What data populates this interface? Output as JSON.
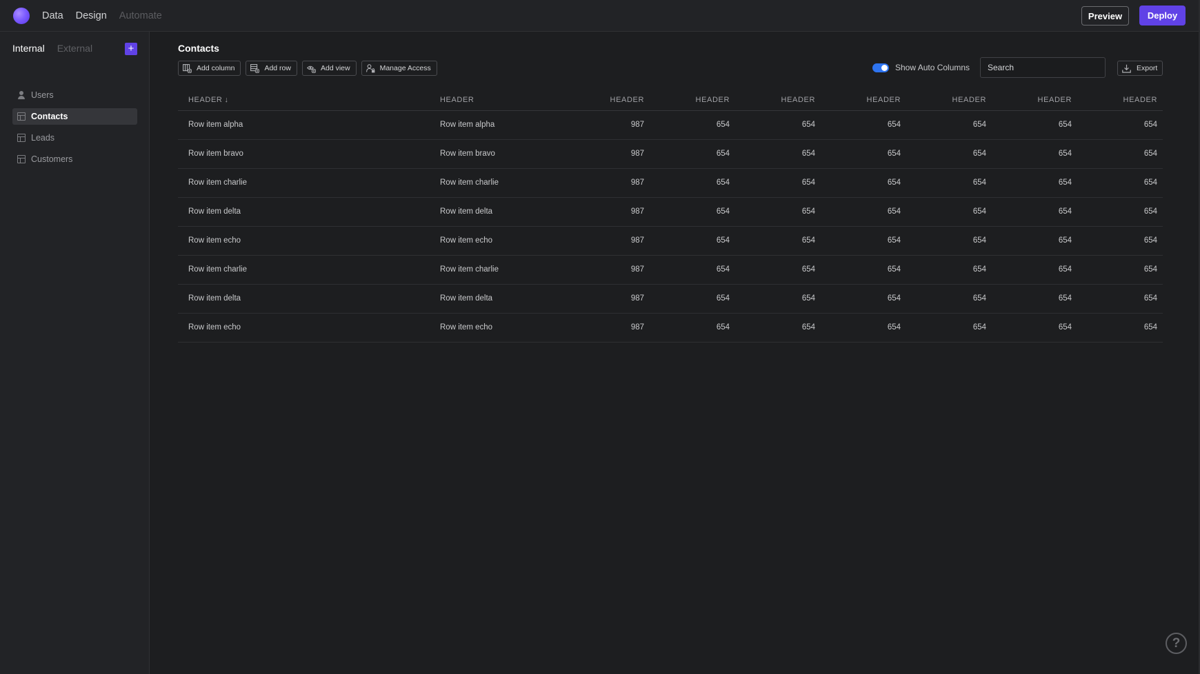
{
  "topbar": {
    "nav": [
      {
        "label": "Data",
        "enabled": true
      },
      {
        "label": "Design",
        "enabled": true
      },
      {
        "label": "Automate",
        "enabled": false
      }
    ],
    "preview_label": "Preview",
    "deploy_label": "Deploy",
    "accent_color": "#6042e6"
  },
  "sidebar": {
    "tabs": [
      {
        "label": "Internal",
        "active": true
      },
      {
        "label": "External",
        "active": false
      }
    ],
    "add_icon": "plus-icon",
    "items": [
      {
        "label": "Users",
        "icon": "user-icon",
        "selected": false
      },
      {
        "label": "Contacts",
        "icon": "table-icon",
        "selected": true
      },
      {
        "label": "Leads",
        "icon": "table-icon",
        "selected": false
      },
      {
        "label": "Customers",
        "icon": "table-icon",
        "selected": false
      }
    ]
  },
  "main": {
    "title": "Contacts",
    "toolbar": {
      "add_column": "Add column",
      "add_row": "Add row",
      "add_view": "Add view",
      "manage_access": "Manage Access"
    },
    "auto_columns_label": "Show Auto Columns",
    "auto_columns_on": true,
    "search_placeholder": "Search",
    "export_label": "Export"
  },
  "table": {
    "headers": [
      "HEADER",
      "HEADER",
      "HEADER",
      "HEADER",
      "HEADER",
      "HEADER",
      "HEADER",
      "HEADER",
      "HEADER"
    ],
    "sort_column": 0,
    "sort_icon": "arrow-down-icon",
    "rows": [
      [
        "Row item alpha",
        "Row item alpha",
        "987",
        "654",
        "654",
        "654",
        "654",
        "654",
        "654"
      ],
      [
        "Row item bravo",
        "Row item bravo",
        "987",
        "654",
        "654",
        "654",
        "654",
        "654",
        "654"
      ],
      [
        "Row item charlie",
        "Row item charlie",
        "987",
        "654",
        "654",
        "654",
        "654",
        "654",
        "654"
      ],
      [
        "Row item delta",
        "Row item delta",
        "987",
        "654",
        "654",
        "654",
        "654",
        "654",
        "654"
      ],
      [
        "Row item echo",
        "Row item echo",
        "987",
        "654",
        "654",
        "654",
        "654",
        "654",
        "654"
      ],
      [
        "Row item charlie",
        "Row item charlie",
        "987",
        "654",
        "654",
        "654",
        "654",
        "654",
        "654"
      ],
      [
        "Row item delta",
        "Row item delta",
        "987",
        "654",
        "654",
        "654",
        "654",
        "654",
        "654"
      ],
      [
        "Row item echo",
        "Row item echo",
        "987",
        "654",
        "654",
        "654",
        "654",
        "654",
        "654"
      ]
    ]
  },
  "help": {
    "label": "?"
  }
}
